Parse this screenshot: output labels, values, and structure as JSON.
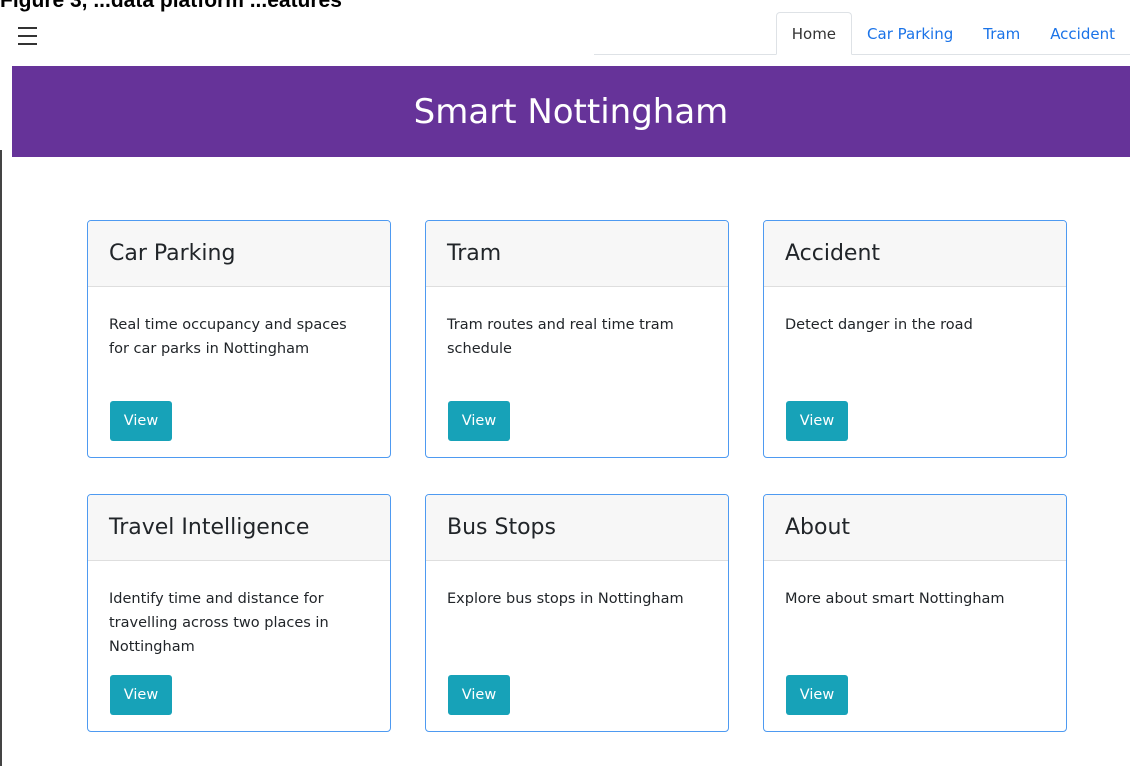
{
  "caption": "Figure 3, ...data platform ...eatures",
  "nav": {
    "tabs": [
      {
        "label": "Home",
        "active": true
      },
      {
        "label": "Car Parking",
        "active": false
      },
      {
        "label": "Tram",
        "active": false
      },
      {
        "label": "Accident",
        "active": false
      }
    ]
  },
  "hero": {
    "title": "Smart Nottingham"
  },
  "cards": [
    {
      "title": "Car Parking",
      "text": "Real time occupancy and spaces for car parks in Nottingham",
      "button": "View"
    },
    {
      "title": "Tram",
      "text": "Tram routes and real time tram schedule",
      "button": "View"
    },
    {
      "title": "Accident",
      "text": "Detect danger in the road",
      "button": "View"
    },
    {
      "title": "Travel Intelligence",
      "text": "Identify time and distance for travelling across two places in Nottingham",
      "button": "View"
    },
    {
      "title": "Bus Stops",
      "text": "Explore bus stops in Nottingham",
      "button": "View"
    },
    {
      "title": "About",
      "text": "More about smart Nottingham",
      "button": "View"
    }
  ],
  "colors": {
    "hero_bg": "#663399",
    "tab_link": "#1a73e8",
    "card_border": "#4e9af1",
    "button_bg": "#17a2b8"
  }
}
